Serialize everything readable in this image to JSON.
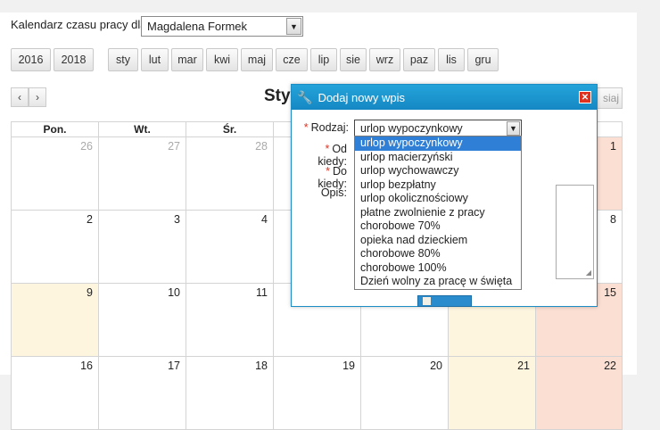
{
  "header": {
    "calendar_label": "Kalendarz czasu pracy dla",
    "person": "Magdalena Formek"
  },
  "years": [
    "2016",
    "2018"
  ],
  "months": [
    "sty",
    "lut",
    "mar",
    "kwi",
    "maj",
    "cze",
    "lip",
    "sie",
    "wrz",
    "paz",
    "lis",
    "gru"
  ],
  "nav": {
    "prev": "‹",
    "next": "›",
    "month_title": "Sty",
    "right_button": "siaj"
  },
  "weekdays": [
    "Pon.",
    "Wt.",
    "Śr.",
    "",
    "",
    "",
    ""
  ],
  "weeks": [
    [
      "26",
      "27",
      "28",
      "",
      "",
      "",
      "1"
    ],
    [
      "2",
      "3",
      "4",
      "",
      "",
      "",
      "8"
    ],
    [
      "9",
      "10",
      "11",
      "",
      "",
      "",
      "15"
    ],
    [
      "16",
      "17",
      "18",
      "19",
      "20",
      "21",
      "22"
    ]
  ],
  "dialog": {
    "title": "Dodaj nowy wpis",
    "rodzaj_label": "Rodzaj:",
    "od_label": "Od kiedy:",
    "do_label": "Do kiedy:",
    "opis_label": "Opis:",
    "rodzaj_value": "urlop wypoczynkowy",
    "options": [
      "urlop wypoczynkowy",
      "urlop macierzyński",
      "urlop wychowawczy",
      "urlop bezpłatny",
      "urlop okolicznościowy",
      "płatne zwolnienie z pracy",
      "chorobowe 70%",
      "opieka nad dzieckiem",
      "chorobowe 80%",
      "chorobowe 100%",
      "Dzień wolny za pracę w święta"
    ]
  },
  "colors": {
    "dialog_header": "#1c95cf",
    "selected_option": "#2f7fd6",
    "today_bg": "#fdf5de",
    "holiday_bg": "#fbdfd3"
  }
}
